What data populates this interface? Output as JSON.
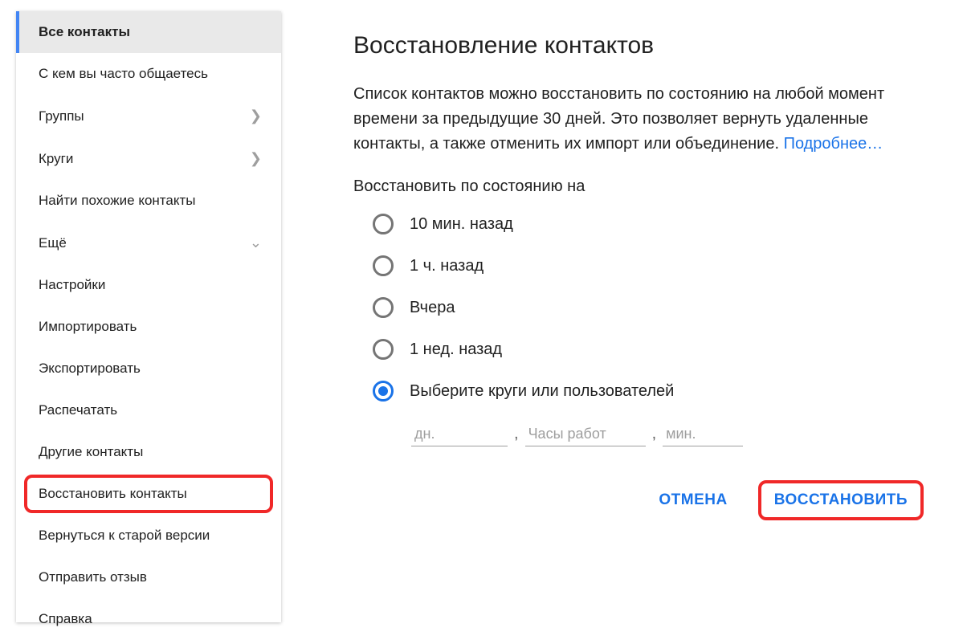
{
  "sidebar": {
    "items": [
      {
        "label": "Все контакты",
        "active": true,
        "chevron": ""
      },
      {
        "label": "С кем вы часто общаетесь",
        "chevron": ""
      },
      {
        "label": "Группы",
        "chevron": "right"
      },
      {
        "label": "Круги",
        "chevron": "right"
      },
      {
        "label": "Найти похожие контакты",
        "chevron": ""
      },
      {
        "label": "Ещё",
        "chevron": "down"
      },
      {
        "label": "Настройки",
        "chevron": ""
      },
      {
        "label": "Импортировать",
        "chevron": ""
      },
      {
        "label": "Экспортировать",
        "chevron": ""
      },
      {
        "label": "Распечатать",
        "chevron": ""
      },
      {
        "label": "Другие контакты",
        "chevron": ""
      },
      {
        "label": "Восстановить контакты",
        "chevron": "",
        "highlighted": true
      },
      {
        "label": "Вернуться к старой версии",
        "chevron": ""
      },
      {
        "label": "Отправить отзыв",
        "chevron": ""
      },
      {
        "label": "Справка",
        "chevron": ""
      }
    ]
  },
  "dialog": {
    "title": "Восстановление контактов",
    "description_prefix": "Список контактов можно восстановить по состоянию на любой момент времени за предыдущие 30 дней. Это позволяет вернуть удаленные контакты, а также отменить их импорт или объединение. ",
    "learn_more": "Подробнее…",
    "subhead": "Восстановить по состоянию на",
    "options": [
      {
        "label": "10 мин. назад",
        "selected": false
      },
      {
        "label": "1 ч. назад",
        "selected": false
      },
      {
        "label": "Вчера",
        "selected": false
      },
      {
        "label": "1 нед. назад",
        "selected": false
      },
      {
        "label": "Выберите круги или пользователей",
        "selected": true
      }
    ],
    "custom": {
      "days_placeholder": "дн.",
      "hours_placeholder": "Часы работ",
      "mins_placeholder": "мин."
    },
    "cancel_label": "ОТМЕНА",
    "restore_label": "ВОССТАНОВИТЬ"
  }
}
